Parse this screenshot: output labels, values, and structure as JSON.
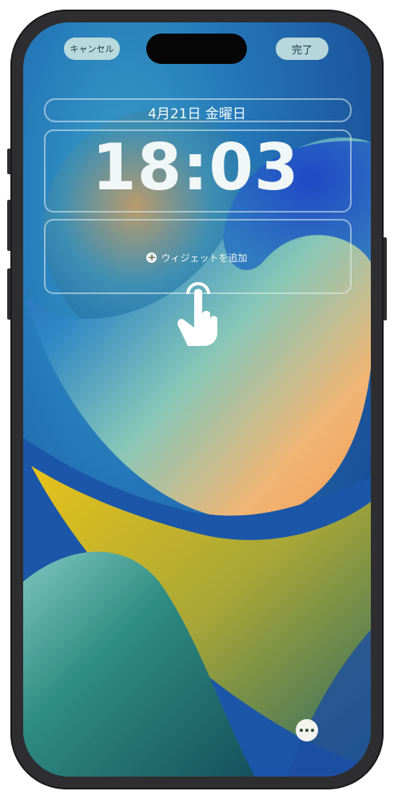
{
  "top_bar": {
    "cancel_label": "キャンセル",
    "done_label": "完了"
  },
  "lock_screen": {
    "date": "4月21日 金曜日",
    "time": "18:03",
    "add_widget_label": "ウィジェットを追加"
  },
  "icons": {
    "add": "plus-circle-icon",
    "gesture": "tap-hand-icon",
    "more": "ellipsis-icon"
  },
  "colors": {
    "wallpaper_blue": "#1d5ea8",
    "wallpaper_orange": "#f0a55a",
    "wallpaper_yellow": "#e8c21a",
    "button_fill": "#cde6e1"
  }
}
